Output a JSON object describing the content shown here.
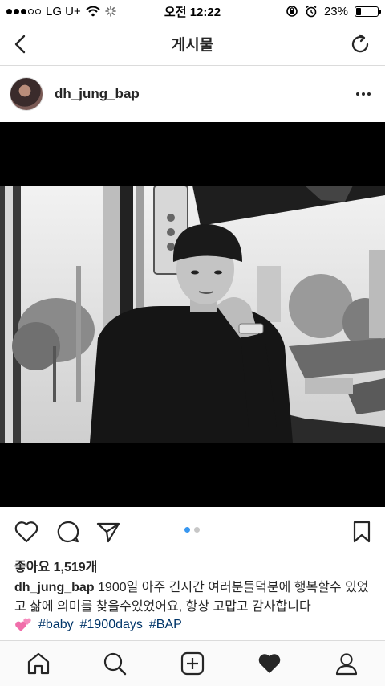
{
  "status_bar": {
    "carrier": "LG U+",
    "time": "오전 12:22",
    "battery": "23%",
    "battery_fraction": 0.23
  },
  "header": {
    "title": "게시물",
    "back_icon": "chevron-left-icon",
    "refresh_icon": "refresh-icon"
  },
  "post": {
    "username": "dh_jung_bap",
    "likes_text": "좋아요 1,519개",
    "caption_user": "dh_jung_bap",
    "caption_text": "1900일 아주 긴시간 여러분들덕분에 행복할수 있었고 삶에 의미를 찾을수있었어요, 항상 고맙고 감사합니다",
    "hashtags": [
      "#baby",
      "#1900days",
      "#BAP"
    ],
    "carousel": {
      "count": 2,
      "active_index": 0
    }
  },
  "colors": {
    "accent": "#3897f0",
    "hashtag": "#003569",
    "heart_emoji": "#f06eaa"
  }
}
